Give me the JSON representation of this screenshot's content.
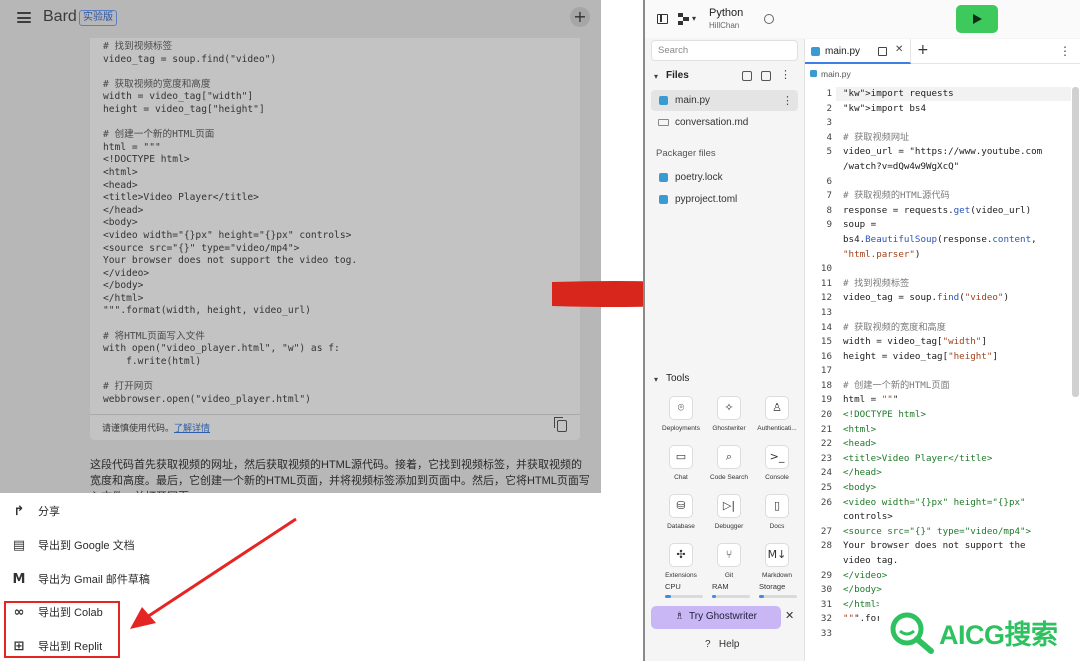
{
  "bard": {
    "title": "Bard",
    "badge": "实验版",
    "code_lines": [
      "# 找到视频标签",
      "video_tag = soup.find(\"video\")",
      "",
      "# 获取视频的宽度和高度",
      "width = video_tag[\"width\"]",
      "height = video_tag[\"height\"]",
      "",
      "# 创建一个新的HTML页面",
      "html = \"\"\"",
      "<!DOCTYPE html>",
      "<html>",
      "<head>",
      "<title>Video Player</title>",
      "</head>",
      "<body>",
      "<video width=\"{}px\" height=\"{}px\" controls>",
      "<source src=\"{}\" type=\"video/mp4\">",
      "Your browser does not support the video tog.",
      "</video>",
      "</body>",
      "</html>",
      "\"\"\".format(width, height, video_url)",
      "",
      "# 将HTML页面写入文件",
      "with open(\"video_player.html\", \"w\") as f:",
      "    f.write(html)",
      "",
      "# 打开网页",
      "webbrowser.open(\"video_player.html\")"
    ],
    "code_note": "请谨慎使用代码。",
    "code_note_link": "了解详情",
    "paragraph": "这段代码首先获取视频的网址，然后获取视频的HTML源代码。接着，它找到视频标签，并获取视频的宽度和高度。最后，它创建一个新的HTML页面，并将视频标签添加到页面中。然后，它将HTML页面写入文件，并打开网页。"
  },
  "export_menu": {
    "items": [
      {
        "label": "分享",
        "icon": "share-icon"
      },
      {
        "label": "导出到 Google 文档",
        "icon": "docs-icon"
      },
      {
        "label": "导出为 Gmail 邮件草稿",
        "icon": "gmail-icon"
      },
      {
        "label": "导出到 Colab",
        "icon": "colab-icon"
      },
      {
        "label": "导出到 Replit",
        "icon": "replit-icon"
      }
    ]
  },
  "replit": {
    "language": "Python",
    "user": "HillChan",
    "search_placeholder": "Search",
    "files_header": "Files",
    "files": [
      {
        "name": "main.py",
        "type": "py"
      },
      {
        "name": "conversation.md",
        "type": "md"
      }
    ],
    "packager_header": "Packager files",
    "packager_files": [
      "poetry.lock",
      "pyproject.toml"
    ],
    "tools_header": "Tools",
    "tools": [
      {
        "label": "Deployments",
        "glyph": "⌾"
      },
      {
        "label": "Ghostwriter",
        "glyph": "✧"
      },
      {
        "label": "Authenticati...",
        "glyph": "♙"
      },
      {
        "label": "Chat",
        "glyph": "▭"
      },
      {
        "label": "Code Search",
        "glyph": "⌕"
      },
      {
        "label": "Console",
        "glyph": ">_"
      },
      {
        "label": "Database",
        "glyph": "⛁"
      },
      {
        "label": "Debugger",
        "glyph": "▷|"
      },
      {
        "label": "Docs",
        "glyph": "▯"
      },
      {
        "label": "Extensions",
        "glyph": "✣"
      },
      {
        "label": "Git",
        "glyph": "⑂"
      },
      {
        "label": "Markdown",
        "glyph": "M↓"
      }
    ],
    "resources": {
      "cpu_label": "CPU",
      "cpu_level": 0.15,
      "ram_label": "RAM",
      "ram_level": 0.1,
      "storage_label": "Storage",
      "storage_level": 0.12
    },
    "ghostwriter_button": "Try Ghostwriter",
    "help": "Help",
    "editor": {
      "tab_name": "main.py",
      "breadcrumb": "main.py",
      "line_numbers": [
        "1",
        "2",
        "3",
        "4",
        "5",
        "",
        "6",
        "7",
        "8",
        "9",
        "",
        "",
        "10",
        "11",
        "12",
        "13",
        "14",
        "15",
        "16",
        "17",
        "18",
        "19",
        "20",
        "21",
        "22",
        "23",
        "24",
        "25",
        "26",
        "",
        "27",
        "28",
        "",
        "29",
        "30",
        "31",
        "32",
        "33"
      ],
      "lines": [
        "import requests",
        "import bs4",
        "",
        "# 获取视频网址",
        "video_url = \"https://www.youtube.com",
        "/watch?v=dQw4w9WgXcQ\"",
        "",
        "# 获取视频的HTML源代码",
        "response = requests.get(video_url)",
        "soup =",
        "bs4.BeautifulSoup(response.content,",
        "\"html.parser\")",
        "",
        "# 找到视频标签",
        "video_tag = soup.find(\"video\")",
        "",
        "# 获取视频的宽度和高度",
        "width = video_tag[\"width\"]",
        "height = video_tag[\"height\"]",
        "",
        "# 创建一个新的HTML页面",
        "html = \"\"\"",
        "<!DOCTYPE html>",
        "<html>",
        "<head>",
        "<title>Video Player</title>",
        "</head>",
        "<body>",
        "<video width=\"{}px\" height=\"{}px\"",
        "controls>",
        "<source src=\"{}\" type=\"video/mp4\">",
        "Your browser does not support the",
        "video tag.",
        "</video>",
        "</body>",
        "</html>",
        "\"\"\".for",
        ""
      ]
    }
  },
  "watermark": "AICG搜索",
  "colors": {
    "accent_red": "#d9261c",
    "run_green": "#3ec95c",
    "watermark_green": "#2ec15f"
  }
}
